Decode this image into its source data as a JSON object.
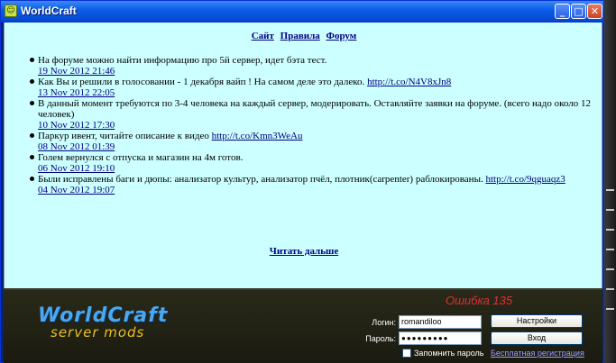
{
  "window": {
    "title": "WorldCraft",
    "icon": "smiley-icon",
    "controls": [
      "_",
      "□",
      "✕"
    ]
  },
  "nav": {
    "site": "Сайт",
    "rules": "Правила",
    "forum": "Форум"
  },
  "news": [
    {
      "text": "На форуме можно найти информацию про 5й сервер, идет бэта тест.",
      "link": "",
      "date": "19 Nov 2012 21:46"
    },
    {
      "text": "Как Вы и решили в голосовании - 1 декабря вайп ! На самом деле это далеко. ",
      "link": "http://t.co/N4V8xJn8",
      "date": "13 Nov 2012 22:05"
    },
    {
      "text": "В данный момент требуются по 3-4 человека на каждый сервер, модерировать. Оставляйте заявки на форуме. (всего надо около 12 человек)",
      "link": "",
      "date": "10 Nov 2012 17:30"
    },
    {
      "text": "Паркур ивент, читайте описание к видео ",
      "link": "http://t.co/Kmn3WeAu",
      "date": "08 Nov 2012 01:39"
    },
    {
      "text": "Голем вернулся с отпуска и магазин на 4м готов.",
      "link": "",
      "date": "06 Nov 2012 19:10"
    },
    {
      "text": "Были исправлены баги и дюпы: анализатор культур, анализатор пчёл, плотник(carpenter) раблокированы. ",
      "link": "http://t.co/9qguaqz3",
      "date": "04 Nov 2012 19:07"
    }
  ],
  "read_more": "Читать дальше",
  "logo": {
    "main": "WorldCraft",
    "sub": "server mods"
  },
  "login": {
    "error": "Ошибка 135",
    "login_label": "Логин:",
    "login_value": "romandiloo",
    "password_label": "Пароль:",
    "password_value": "●●●●●●●●●",
    "settings_button": "Настройки",
    "login_button": "Вход",
    "remember_label": "Запомнить пароль",
    "register_link": "Бесплатная регистрация"
  },
  "colors": {
    "content_bg": "#ccffff",
    "link": "#000080",
    "error": "#e03030",
    "logo_blue": "#4aa8f0",
    "logo_yellow": "#e8c020"
  }
}
